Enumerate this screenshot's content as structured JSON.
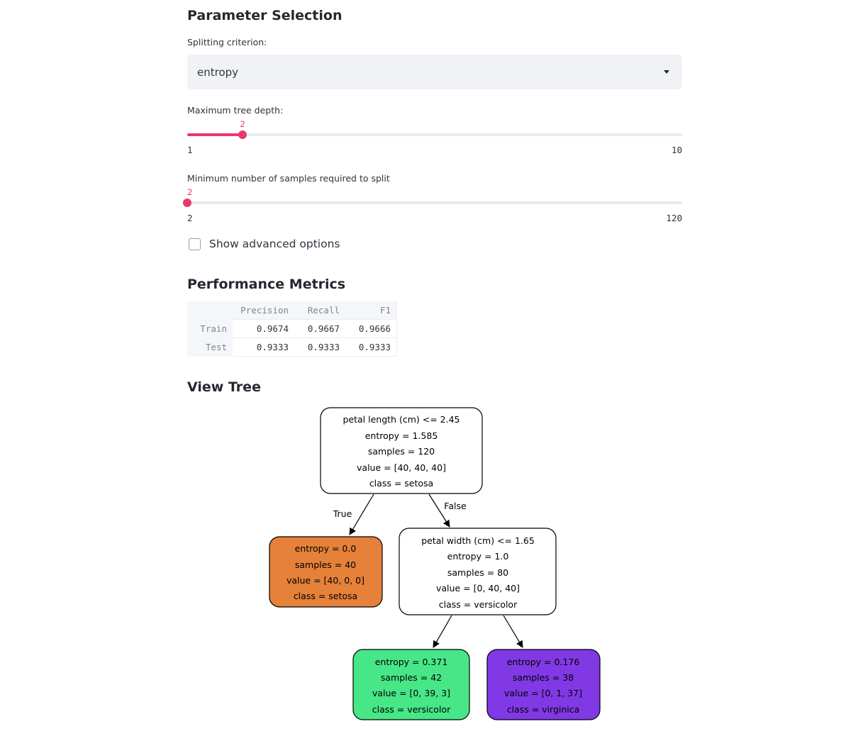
{
  "parameter_section": {
    "title": "Parameter Selection",
    "criterion": {
      "label": "Splitting criterion:",
      "selected": "entropy"
    },
    "max_depth": {
      "label": "Maximum tree depth:",
      "value": "2",
      "min": "1",
      "max": "10",
      "fraction": 0.1111
    },
    "min_samples": {
      "label": "Minimum number of samples required to split",
      "value": "2",
      "min": "2",
      "max": "120",
      "fraction": 0.0
    },
    "advanced": {
      "label": "Show advanced options",
      "checked": false
    }
  },
  "metrics_section": {
    "title": "Performance Metrics",
    "columns": [
      "Precision",
      "Recall",
      "F1"
    ],
    "rows": [
      {
        "name": "Train",
        "values": [
          "0.9674",
          "0.9667",
          "0.9666"
        ]
      },
      {
        "name": "Test",
        "values": [
          "0.9333",
          "0.9333",
          "0.9333"
        ]
      }
    ]
  },
  "tree_section": {
    "title": "View Tree",
    "edge_true": "True",
    "edge_false": "False",
    "nodes": {
      "root": [
        "petal length (cm) <= 2.45",
        "entropy = 1.585",
        "samples = 120",
        "value = [40, 40, 40]",
        "class = setosa"
      ],
      "left": [
        "entropy = 0.0",
        "samples = 40",
        "value = [40, 0, 0]",
        "class = setosa"
      ],
      "right": [
        "petal width (cm) <= 1.65",
        "entropy = 1.0",
        "samples = 80",
        "value = [0, 40, 40]",
        "class = versicolor"
      ],
      "right_left": [
        "entropy = 0.371",
        "samples = 42",
        "value = [0, 39, 3]",
        "class = versicolor"
      ],
      "right_right": [
        "entropy = 0.176",
        "samples = 38",
        "value = [0, 1, 37]",
        "class = virginica"
      ]
    },
    "colors": {
      "root": "#ffffff",
      "left": "#e58139",
      "right": "#ffffff",
      "right_left": "#47e788",
      "right_right": "#8139e5"
    }
  }
}
